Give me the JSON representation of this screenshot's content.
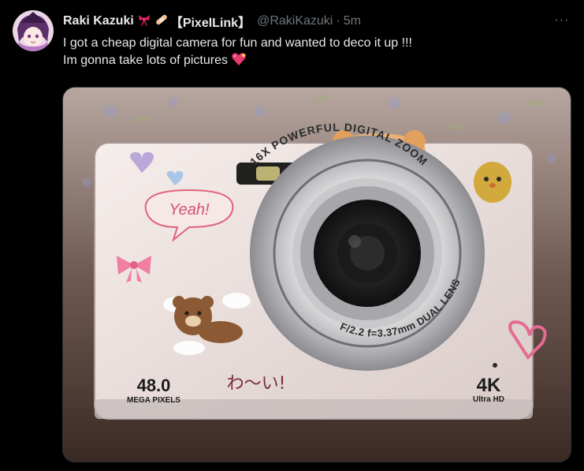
{
  "author": {
    "display_name": "Raki Kazuki",
    "name_emojis": [
      "ribbon-emoji",
      "bandage-emoji"
    ],
    "affiliation": "【PixelLink】",
    "handle": "@RakiKazuki",
    "separator": "·",
    "timestamp": "5m"
  },
  "menu": {
    "more_label": "···"
  },
  "tweet": {
    "text_lines": [
      "I got a cheap digital camera for fun and wanted to deco it up !!!",
      "Im gonna take lots of pictures"
    ],
    "trailing_emoji": "sparkling-heart-emoji"
  },
  "media": {
    "camera": {
      "lens_ring_text_top": "16X POWERFUL DIGITAL ZOOM",
      "lens_ring_text_bottom": "F/2.2 f=3.37mm DUAL LENS",
      "megapixels_value": "48.0",
      "megapixels_label": "MEGA PIXELS",
      "resolution_value": "4K",
      "resolution_label": "Ultra HD",
      "sticker_speech_bubble": "Yeah!",
      "sticker_handwriting": "わ〜い!"
    }
  },
  "colors": {
    "background": "#000000",
    "text_primary": "#e7e9ea",
    "text_secondary": "#71767b",
    "border": "#2f3336"
  }
}
